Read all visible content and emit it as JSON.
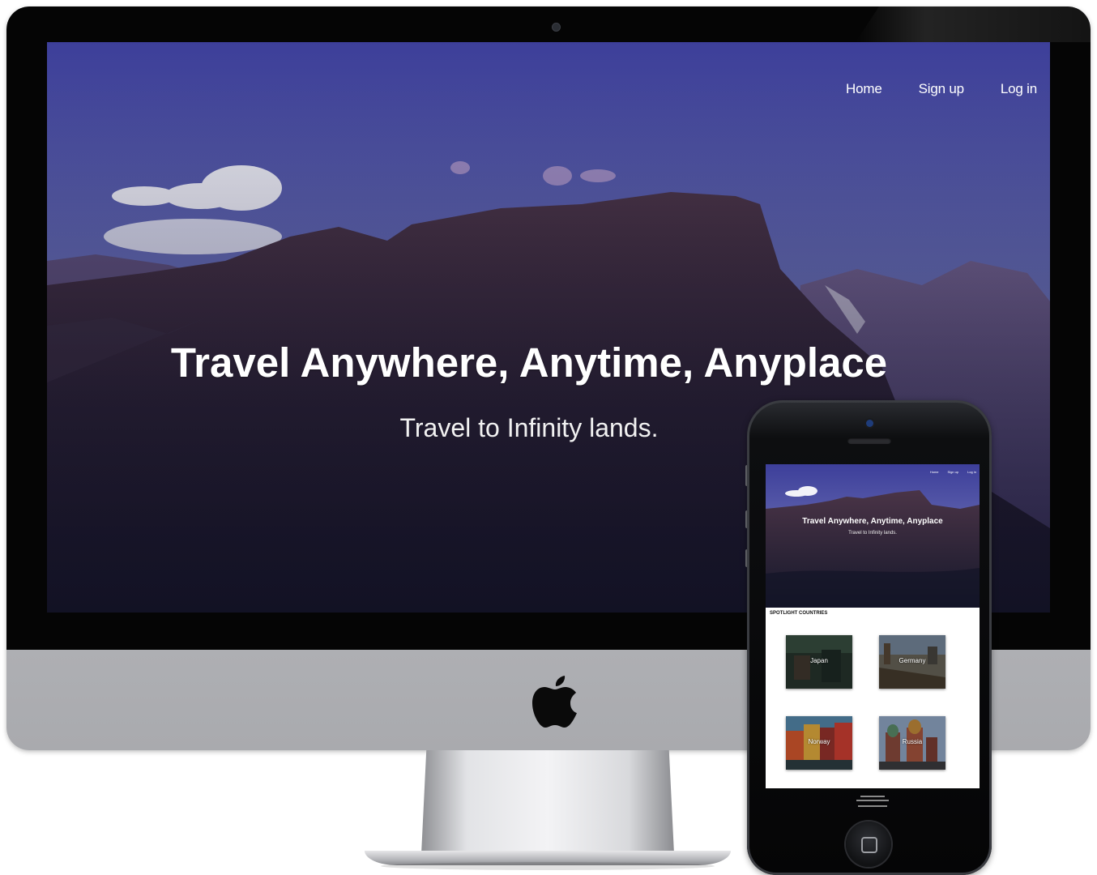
{
  "desktop": {
    "nav": {
      "home": "Home",
      "signup": "Sign up",
      "login": "Log in"
    },
    "hero": {
      "title": "Travel Anywhere, Anytime, Anyplace",
      "subtitle": "Travel to Infinity lands."
    }
  },
  "mobile": {
    "nav": {
      "home": "Home",
      "signup": "Sign up",
      "login": "Log in"
    },
    "hero": {
      "title": "Travel Anywhere, Anytime, Anyplace",
      "subtitle": "Travel to Infinity lands."
    },
    "spotlight": {
      "heading": "SPOTLIGHT COUNTRIES",
      "countries": [
        "Japan",
        "Germany",
        "Norway",
        "Russia"
      ]
    }
  },
  "colors": {
    "sky_top": "#3f3f9c",
    "sky_bottom": "#7d86c2",
    "mountain": "#3a2b3f",
    "device_bezel": "#050505",
    "device_silver": "#c0c1c5"
  },
  "icons": {
    "brand": "apple-logo-icon",
    "phone_home": "home-button-icon"
  }
}
